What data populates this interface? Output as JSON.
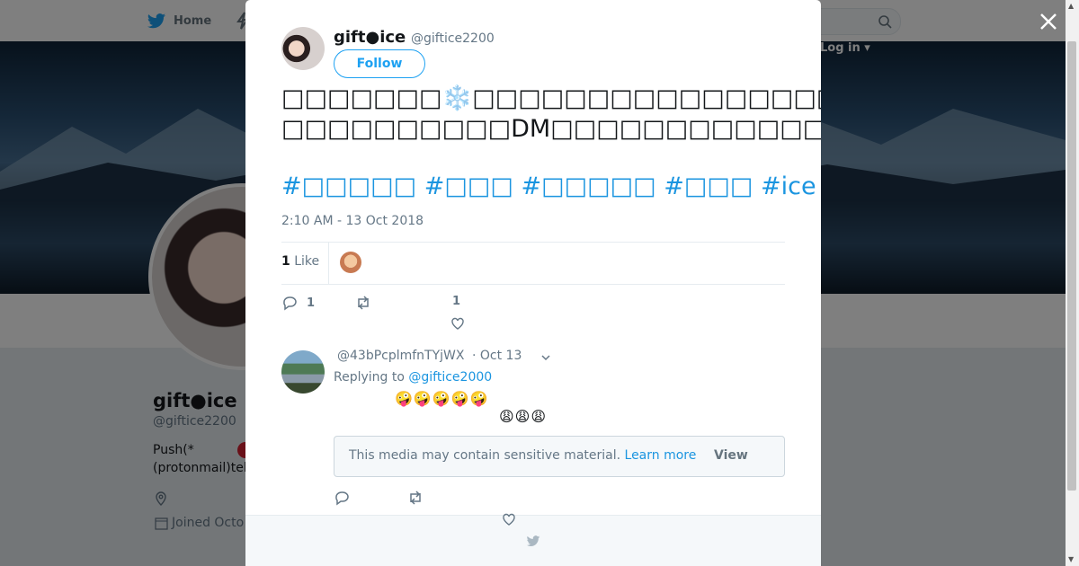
{
  "nav": {
    "home_label": "Home",
    "login_label": "Log in"
  },
  "background_profile": {
    "name": "gift●ice",
    "handle": "@giftice2200",
    "bio_line1": "Push(*",
    "bio_line2": "(protonmail)tel",
    "joined": "Joined Octo"
  },
  "modal": {
    "author": {
      "name": "gift●ice",
      "handle": "@giftice2200"
    },
    "follow_label": "Follow",
    "tweet_line1_pre": "□□□□□□□",
    "tweet_snow": "❄️",
    "tweet_line1_post": "□□□□□□□□□□□□□□□□□□□□□□□□□□□□□□□□□□□",
    "tweet_line2_pre": "□□□□□□□□□□DM□□□□□□□□□□□□□□□□□□□□□□□□□□□□□□□□□",
    "tweet_secret": "㊙",
    "hashtags": "#□□□□□ #□□□ #□□□□□ #□□□ #ice # #□□□□ #□□□□",
    "timestamp": "2:10 AM - 13 Oct 2018",
    "likes_count": "1",
    "likes_label": "Like",
    "reply_count": "1",
    "like_action_count": "1",
    "reply": {
      "handle": "@43bPcplmfnTYjWX",
      "date": "· Oct 13",
      "replying_prefix": "Replying to",
      "replying_to": "@giftice2000",
      "emoji_line1": "🤪🤪🤪🤪🤪",
      "emoji_line2": "😩😩😩",
      "sensitive_text": "This media may contain sensitive material.",
      "learn_more": "Learn more",
      "view_label": "View"
    }
  },
  "colors": {
    "twitter_blue": "#1da1f2",
    "link_blue": "#1b95e0",
    "secret_red": "#dd2e44"
  }
}
